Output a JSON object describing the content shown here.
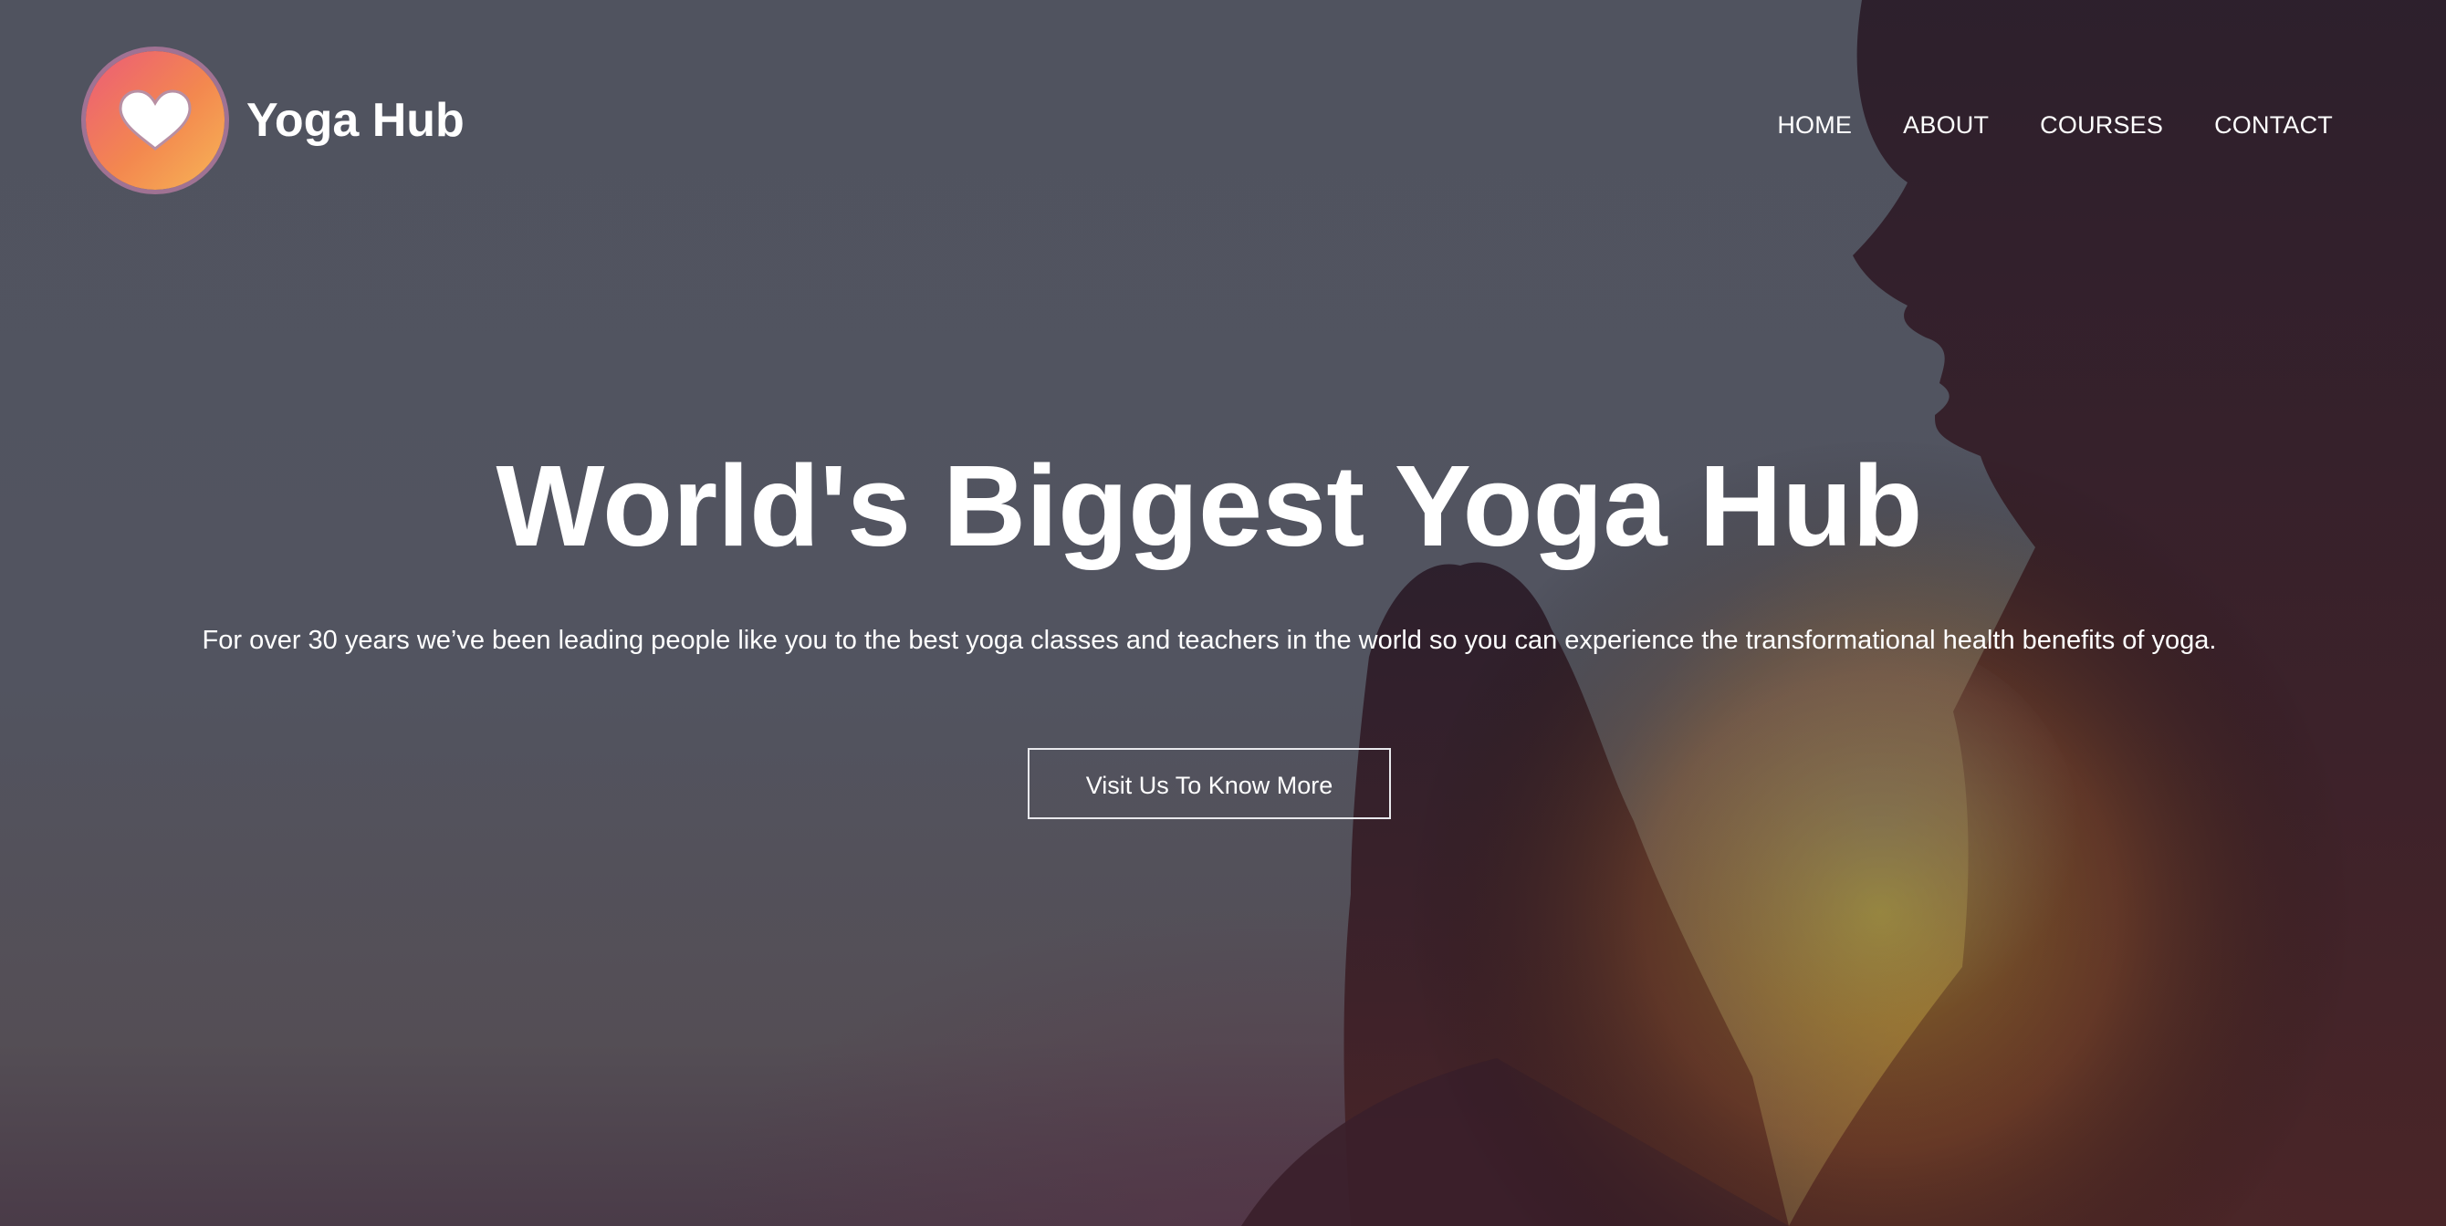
{
  "brand": {
    "name": "Yoga Hub",
    "logo_icon": "heart-icon",
    "logo_gradient": [
      "#ec5b78",
      "#f7b556"
    ]
  },
  "nav": {
    "items": [
      {
        "label": "HOME"
      },
      {
        "label": "ABOUT"
      },
      {
        "label": "COURSES"
      },
      {
        "label": "CONTACT"
      }
    ]
  },
  "hero": {
    "headline": "World's Biggest Yoga Hub",
    "subtitle": "For over 30 years we’ve been leading people like you to the best yoga classes and teachers in the world so you can experience the transformational health benefits of yoga.",
    "cta_label": "Visit Us To Know More",
    "background_image": "person-praying-silhouette"
  },
  "colors": {
    "overlay": "#50535f",
    "text": "#ffffff",
    "accent": "#f3884f"
  }
}
